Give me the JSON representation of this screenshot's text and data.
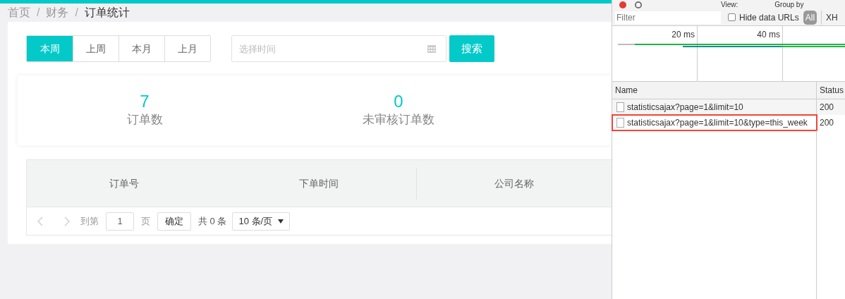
{
  "breadcrumb": [
    {
      "label": "首页",
      "current": false
    },
    {
      "label": "财务",
      "current": false
    },
    {
      "label": "订单统计",
      "current": true
    }
  ],
  "breadcrumb_separator": "/",
  "period_tabs": [
    {
      "label": "本周",
      "selected": true
    },
    {
      "label": "上周",
      "selected": false
    },
    {
      "label": "本月",
      "selected": false
    },
    {
      "label": "上月",
      "selected": false
    }
  ],
  "date_field": {
    "placeholder": "选择时间"
  },
  "search_button": "搜索",
  "stats": [
    {
      "value": "7",
      "label": "订单数"
    },
    {
      "value": "0",
      "label": "未审核订单数"
    }
  ],
  "table": {
    "columns": [
      "订单号",
      "下单时间",
      "公司名称"
    ]
  },
  "pagination": {
    "goto_label": "到第",
    "page": "1",
    "page_suffix": "页",
    "confirm": "确定",
    "total": "共 0 条",
    "page_size": "10 条/页"
  },
  "devtools": {
    "toolbar": [
      "View:",
      "Group by"
    ],
    "filter": {
      "placeholder": "Filter"
    },
    "hide_data_urls": {
      "label": "Hide data URLs",
      "checked": false
    },
    "type_filters": [
      {
        "label": "All",
        "selected": true
      },
      {
        "label": "XH",
        "selected": false
      }
    ],
    "timeline_ticks": [
      "20 ms",
      "40 ms"
    ],
    "columns": [
      "Name",
      "Status"
    ],
    "requests": [
      {
        "name": "statisticsajax?page=1&limit=10",
        "status": "200",
        "highlighted": false
      },
      {
        "name": "statisticsajax?page=1&limit=10&type=this_week",
        "status": "200",
        "highlighted": true
      }
    ]
  }
}
